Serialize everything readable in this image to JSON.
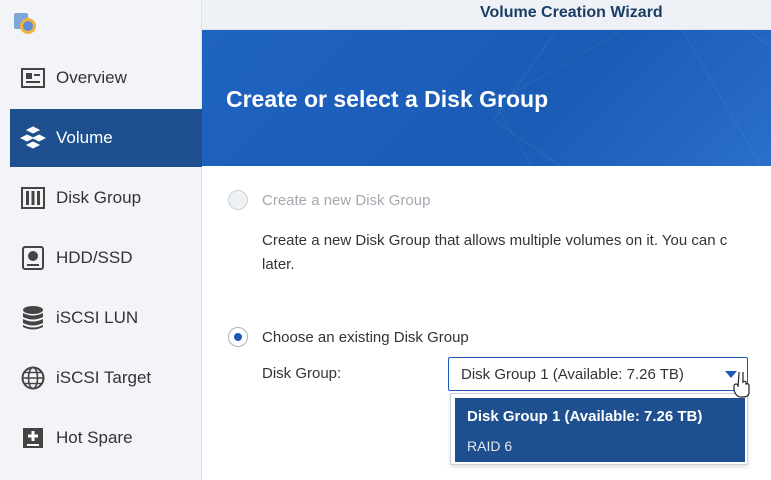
{
  "window": {
    "title": "Volume Creation Wizard"
  },
  "sidebar": {
    "items": [
      {
        "label": "Overview",
        "icon": "overview-icon"
      },
      {
        "label": "Volume",
        "icon": "volume-icon",
        "active": true
      },
      {
        "label": "Disk Group",
        "icon": "disk-group-icon"
      },
      {
        "label": "HDD/SSD",
        "icon": "hdd-icon"
      },
      {
        "label": "iSCSI LUN",
        "icon": "iscsi-lun-icon"
      },
      {
        "label": "iSCSI Target",
        "icon": "globe-icon"
      },
      {
        "label": "Hot Spare",
        "icon": "hot-spare-icon"
      }
    ]
  },
  "wizard": {
    "heading": "Create or select a Disk Group",
    "option_new": {
      "label": "Create a new Disk Group",
      "description_line1": "Create a new Disk Group that allows multiple volumes on it. You can c",
      "description_line2": "later."
    },
    "option_existing": {
      "label": "Choose an existing Disk Group"
    },
    "disk_group_label": "Disk Group:",
    "disk_group_select": {
      "value": "Disk Group 1 (Available: 7.26 TB)",
      "options": [
        {
          "title": "Disk Group 1 (Available: 7.26 TB)",
          "subtitle": "RAID 6"
        }
      ]
    }
  },
  "colors": {
    "accent": "#1e4f8f",
    "banner": "#1f63c1",
    "radio_selected": "#1d5ab5"
  }
}
